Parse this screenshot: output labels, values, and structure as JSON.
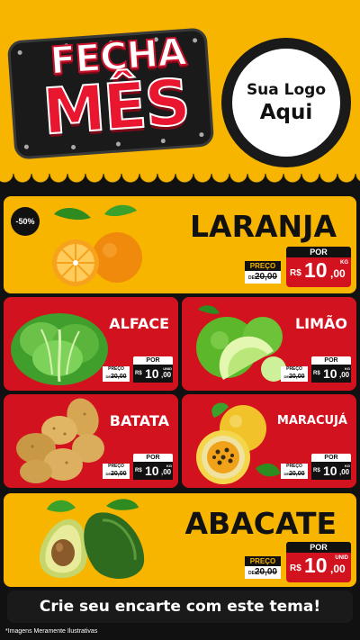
{
  "header": {
    "title_line1": "FECHA",
    "title_line2": "MÊS",
    "logo_line1": "Sua Logo",
    "logo_line2": "Aqui"
  },
  "common": {
    "por": "POR",
    "preco": "PREÇO",
    "de": "DE",
    "old_price": "20,00",
    "currency": "R$",
    "price_int": "10",
    "price_dec": ",00"
  },
  "products": {
    "laranja": {
      "name": "LARANJA",
      "discount": "-50%",
      "unit": "KG"
    },
    "alface": {
      "name": "ALFACE",
      "unit": "UNID"
    },
    "limao": {
      "name": "LIMÃO",
      "unit": "KG"
    },
    "batata": {
      "name": "BATATA",
      "unit": "KG"
    },
    "maracuja": {
      "name": "MARACUJÁ",
      "unit": "KG"
    },
    "abacate": {
      "name": "ABACATE",
      "unit": "UNID"
    }
  },
  "footer": {
    "cta": "Crie seu encarte com este tema!",
    "disclaimer": "*Imagens Meramente Ilustrativas"
  },
  "colors": {
    "yellow": "#f7b500",
    "red": "#d3121f",
    "black": "#111111"
  }
}
